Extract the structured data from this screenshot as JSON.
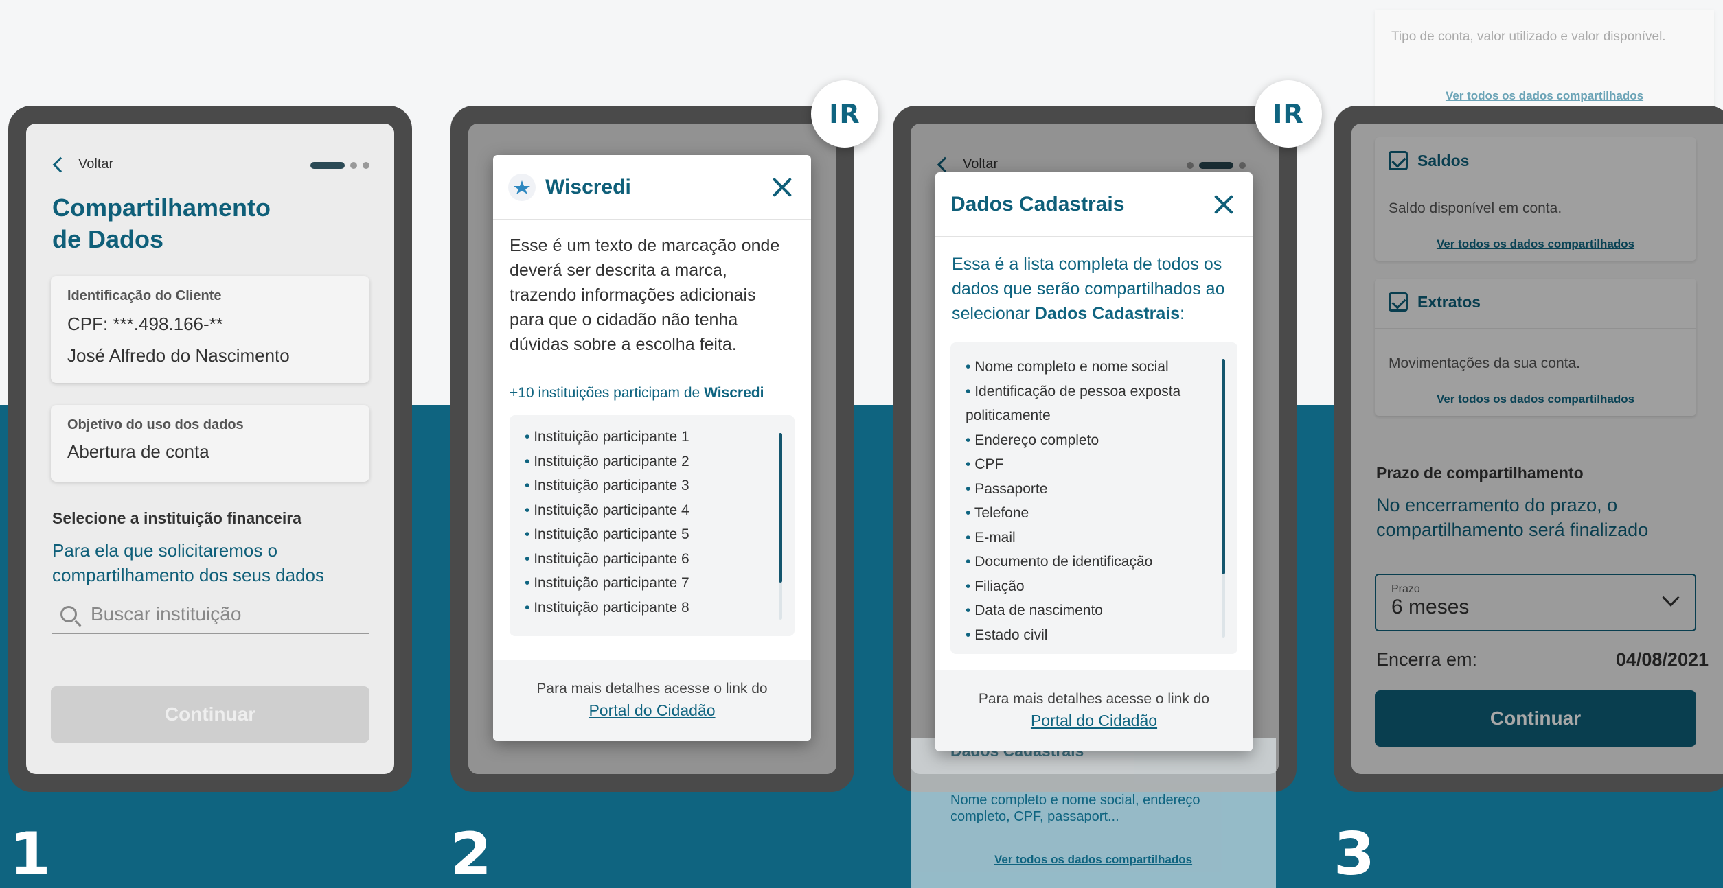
{
  "colors": {
    "accent": "#0f6480",
    "primary_text": "#0f5f79",
    "background": "#f5f6f7"
  },
  "steps": [
    "1",
    "2",
    "3"
  ],
  "badges": {
    "ir": "IR"
  },
  "screen1": {
    "back": "Voltar",
    "title_line1": "Compartilhamento",
    "title_line2": "de Dados",
    "client": {
      "label": "Identificação do Cliente",
      "cpf": "CPF: ***.498.166-**",
      "name": "José Alfredo do Nascimento"
    },
    "purpose": {
      "label": "Objetivo do uso dos dados",
      "value": "Abertura de conta"
    },
    "institution": {
      "label": "Selecione a instituição financeira",
      "text": "Para ela que solicitaremos o compartilhamento dos seus dados"
    },
    "search_placeholder": "Buscar instituição",
    "continue": "Continuar"
  },
  "screen2": {
    "modal_title": "Wiscredi",
    "logo_icon": "star-logo-icon",
    "description": "Esse é um texto de marcação onde deverá ser descrita a marca, trazendo informações adicionais para que o cidadão não tenha dúvidas sobre a escolha feita.",
    "count_prefix": "+10 instituições participam de ",
    "count_brand": "Wiscredi",
    "institutions": [
      "Instituição participante 1",
      "Instituição participante 2",
      "Instituição participante 3",
      "Instituição participante 4",
      "Instituição participante 5",
      "Instituição participante 6",
      "Instituição participante 7",
      "Instituição participante 8"
    ],
    "footer_text": "Para mais detalhes acesse o link do",
    "footer_link": "Portal do Cidadão"
  },
  "screen3": {
    "back": "Voltar",
    "modal_title": "Dados Cadastrais",
    "description_prefix": "Essa é a lista completa de todos os dados que serão compartilhados ao selecionar ",
    "description_bold": "Dados Cadastrais",
    "description_suffix": ":",
    "items": [
      "Nome completo e nome social",
      "Identificação de pessoa exposta politicamente",
      "Endereço completo",
      "CPF",
      "Passaporte",
      "Telefone",
      "E-mail",
      "Documento de identificação",
      "Filiação",
      "Data de nascimento",
      "Estado civil"
    ],
    "footer_text": "Para mais detalhes acesse o link do",
    "footer_link": "Portal do Cidadão",
    "behind_title": "Dados Cadastrais",
    "behind_desc": "Nome completo e nome social, endereço completo, CPF, passaport...",
    "behind_link": "Ver todos os dados compartilhados"
  },
  "screen4": {
    "top_desc": "Tipo de conta, valor utilizado e valor disponível.",
    "top_link": "Ver todos os dados compartilhados",
    "saldos": {
      "title": "Saldos",
      "desc": "Saldo disponível em conta.",
      "link": "Ver todos os dados compartilhados"
    },
    "extratos": {
      "title": "Extratos",
      "desc": "Movimentações da sua conta.",
      "link": "Ver todos os dados compartilhados"
    },
    "prazo_label": "Prazo de compartilhamento",
    "prazo_text": "No encerramento do prazo, o compartilhamento será finalizado",
    "select_label": "Prazo",
    "select_value": "6 meses",
    "encerra_label": "Encerra em:",
    "encerra_date": "04/08/2021",
    "continue": "Continuar"
  }
}
